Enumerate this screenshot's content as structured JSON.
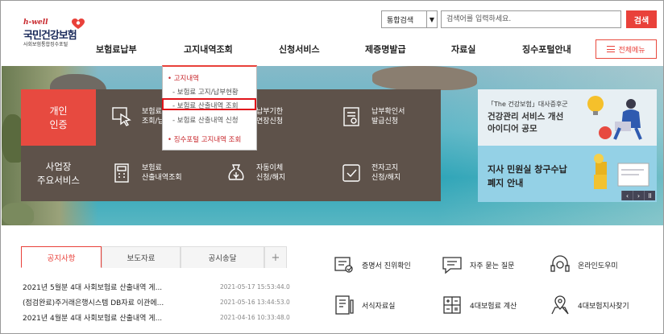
{
  "logo": {
    "tagline": "h-well",
    "name": "국민건강보험",
    "sub": "사회보험통합징수포털"
  },
  "search": {
    "select_value": "통합검색",
    "placeholder": "검색어를 입력하세요.",
    "button": "검색"
  },
  "nav": {
    "items": [
      "보험료납부",
      "고지내역조회",
      "신청서비스",
      "제증명발급",
      "자료실",
      "징수포털안내"
    ],
    "all_menu": "전체메뉴"
  },
  "dropdown": {
    "items": [
      {
        "label": "고지내역",
        "type": "category"
      },
      {
        "label": "- 보험료 고지/납부현황",
        "type": "sub"
      },
      {
        "label": "- 보험료 산출내역 조회",
        "type": "sub",
        "highlighted": true
      },
      {
        "label": "- 보험료 산출내역 신청",
        "type": "sub"
      },
      {
        "label": "징수포털 고지내역 조회",
        "type": "category"
      }
    ]
  },
  "tiles": {
    "personal": [
      "개인",
      "인증"
    ],
    "business": [
      "사업장",
      "주요서비스"
    ],
    "row1": [
      {
        "l1": "보험료",
        "l2": "조회/납부",
        "icon": "cursor-click-icon"
      },
      {
        "l1": "납부기한",
        "l2": "연장신청",
        "icon": "calendar-icon"
      },
      {
        "l1": "납부확인서",
        "l2": "발급신청",
        "icon": "certificate-icon"
      }
    ],
    "row2": [
      {
        "l1": "보험료",
        "l2": "산출내역조회",
        "icon": "calculator-icon"
      },
      {
        "l1": "자동이체",
        "l2": "신청/해지",
        "icon": "money-bag-icon"
      },
      {
        "l1": "전자고지",
        "l2": "신청/해지",
        "icon": "phone-notice-icon"
      }
    ]
  },
  "banners": [
    {
      "small": "「The 건강보험」대사증후군",
      "line1": "건강관리 서비스 개선",
      "line2": "아이디어 공모"
    },
    {
      "line1": "지사 민원실 창구수납",
      "line2": "폐지 안내"
    }
  ],
  "banner_controls": [
    "‹",
    "›",
    "ll"
  ],
  "notice": {
    "tabs": [
      "공지사항",
      "보도자료",
      "공시송달",
      "+"
    ],
    "items": [
      {
        "title": "2021년 5월분 4대 사회보험료 산출내역 게...",
        "date": "2021-05-17 15:53:44.0"
      },
      {
        "title": "(점검완료)주거래은행시스템 DB자료 이관에...",
        "date": "2021-05-16 13:44:53.0"
      },
      {
        "title": "2021년 4월분 4대 사회보험료 산출내역 게...",
        "date": "2021-04-16 10:33:48.0"
      }
    ]
  },
  "quick_links": [
    {
      "label": "증명서 진위확인",
      "icon": "certificate-check-icon"
    },
    {
      "label": "자주 묻는 질문",
      "icon": "chat-faq-icon"
    },
    {
      "label": "온라인도우미",
      "icon": "headset-icon"
    },
    {
      "label": "서식자료실",
      "icon": "document-pen-icon"
    },
    {
      "label": "4대보험료 계산",
      "icon": "calculator-icon"
    },
    {
      "label": "4대보험지사찾기",
      "icon": "map-pin-icon"
    }
  ]
}
